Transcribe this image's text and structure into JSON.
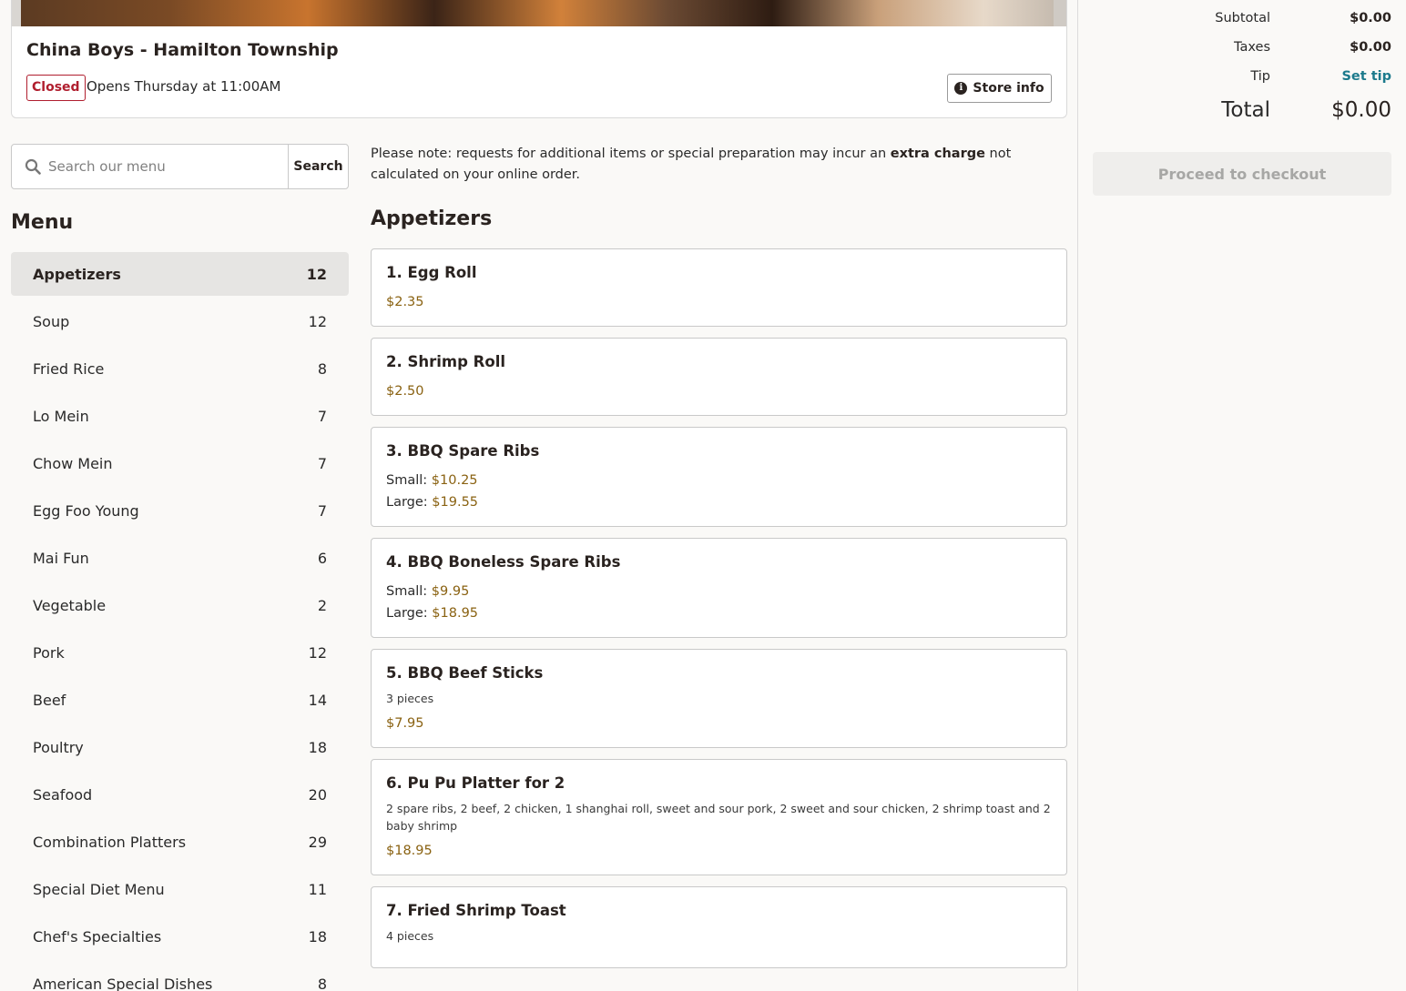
{
  "store": {
    "name": "China Boys - Hamilton Township",
    "status": "Closed",
    "opens": "Opens Thursday at 11:00AM",
    "store_info_label": "Store info"
  },
  "search": {
    "placeholder": "Search our menu",
    "button_label": "Search"
  },
  "menu": {
    "title": "Menu",
    "categories": [
      {
        "name": "Appetizers",
        "count": "12",
        "active": true
      },
      {
        "name": "Soup",
        "count": "12"
      },
      {
        "name": "Fried Rice",
        "count": "8"
      },
      {
        "name": "Lo Mein",
        "count": "7"
      },
      {
        "name": "Chow Mein",
        "count": "7"
      },
      {
        "name": "Egg Foo Young",
        "count": "7"
      },
      {
        "name": "Mai Fun",
        "count": "6"
      },
      {
        "name": "Vegetable",
        "count": "2"
      },
      {
        "name": "Pork",
        "count": "12"
      },
      {
        "name": "Beef",
        "count": "14"
      },
      {
        "name": "Poultry",
        "count": "18"
      },
      {
        "name": "Seafood",
        "count": "20"
      },
      {
        "name": "Combination Platters",
        "count": "29"
      },
      {
        "name": "Special Diet Menu",
        "count": "11"
      },
      {
        "name": "Chef's Specialties",
        "count": "18"
      },
      {
        "name": "American Special Dishes",
        "count": "8"
      }
    ]
  },
  "note": {
    "before": "Please note: requests for additional items or special preparation may incur an ",
    "bold": "extra charge",
    "after": " not calculated on your online order."
  },
  "section": {
    "title": "Appetizers",
    "items": [
      {
        "name": "1. Egg Roll",
        "prices": [
          {
            "label": "",
            "price": "$2.35"
          }
        ]
      },
      {
        "name": "2. Shrimp Roll",
        "prices": [
          {
            "label": "",
            "price": "$2.50"
          }
        ]
      },
      {
        "name": "3. BBQ Spare Ribs",
        "prices": [
          {
            "label": "Small: ",
            "price": "$10.25"
          },
          {
            "label": "Large: ",
            "price": "$19.55"
          }
        ]
      },
      {
        "name": "4. BBQ Boneless Spare Ribs",
        "prices": [
          {
            "label": "Small: ",
            "price": "$9.95"
          },
          {
            "label": "Large: ",
            "price": "$18.95"
          }
        ]
      },
      {
        "name": "5. BBQ Beef Sticks",
        "desc": "3 pieces",
        "prices": [
          {
            "label": "",
            "price": "$7.95"
          }
        ]
      },
      {
        "name": "6. Pu Pu Platter for 2",
        "desc": "2 spare ribs, 2 beef, 2 chicken, 1 shanghai roll, sweet and sour pork, 2 sweet and sour chicken, 2 shrimp toast and 2 baby shrimp",
        "prices": [
          {
            "label": "",
            "price": "$18.95"
          }
        ]
      },
      {
        "name": "7. Fried Shrimp Toast",
        "desc": "4 pieces",
        "prices": []
      }
    ]
  },
  "summary": {
    "subtotal_label": "Subtotal",
    "subtotal_value": "$0.00",
    "taxes_label": "Taxes",
    "taxes_value": "$0.00",
    "tip_label": "Tip",
    "tip_value": "Set tip",
    "total_label": "Total",
    "total_value": "$0.00",
    "checkout_label": "Proceed to checkout"
  },
  "colors": {
    "closed": "#b01e2e",
    "price": "#8a6212",
    "link": "#1c7a8c"
  }
}
